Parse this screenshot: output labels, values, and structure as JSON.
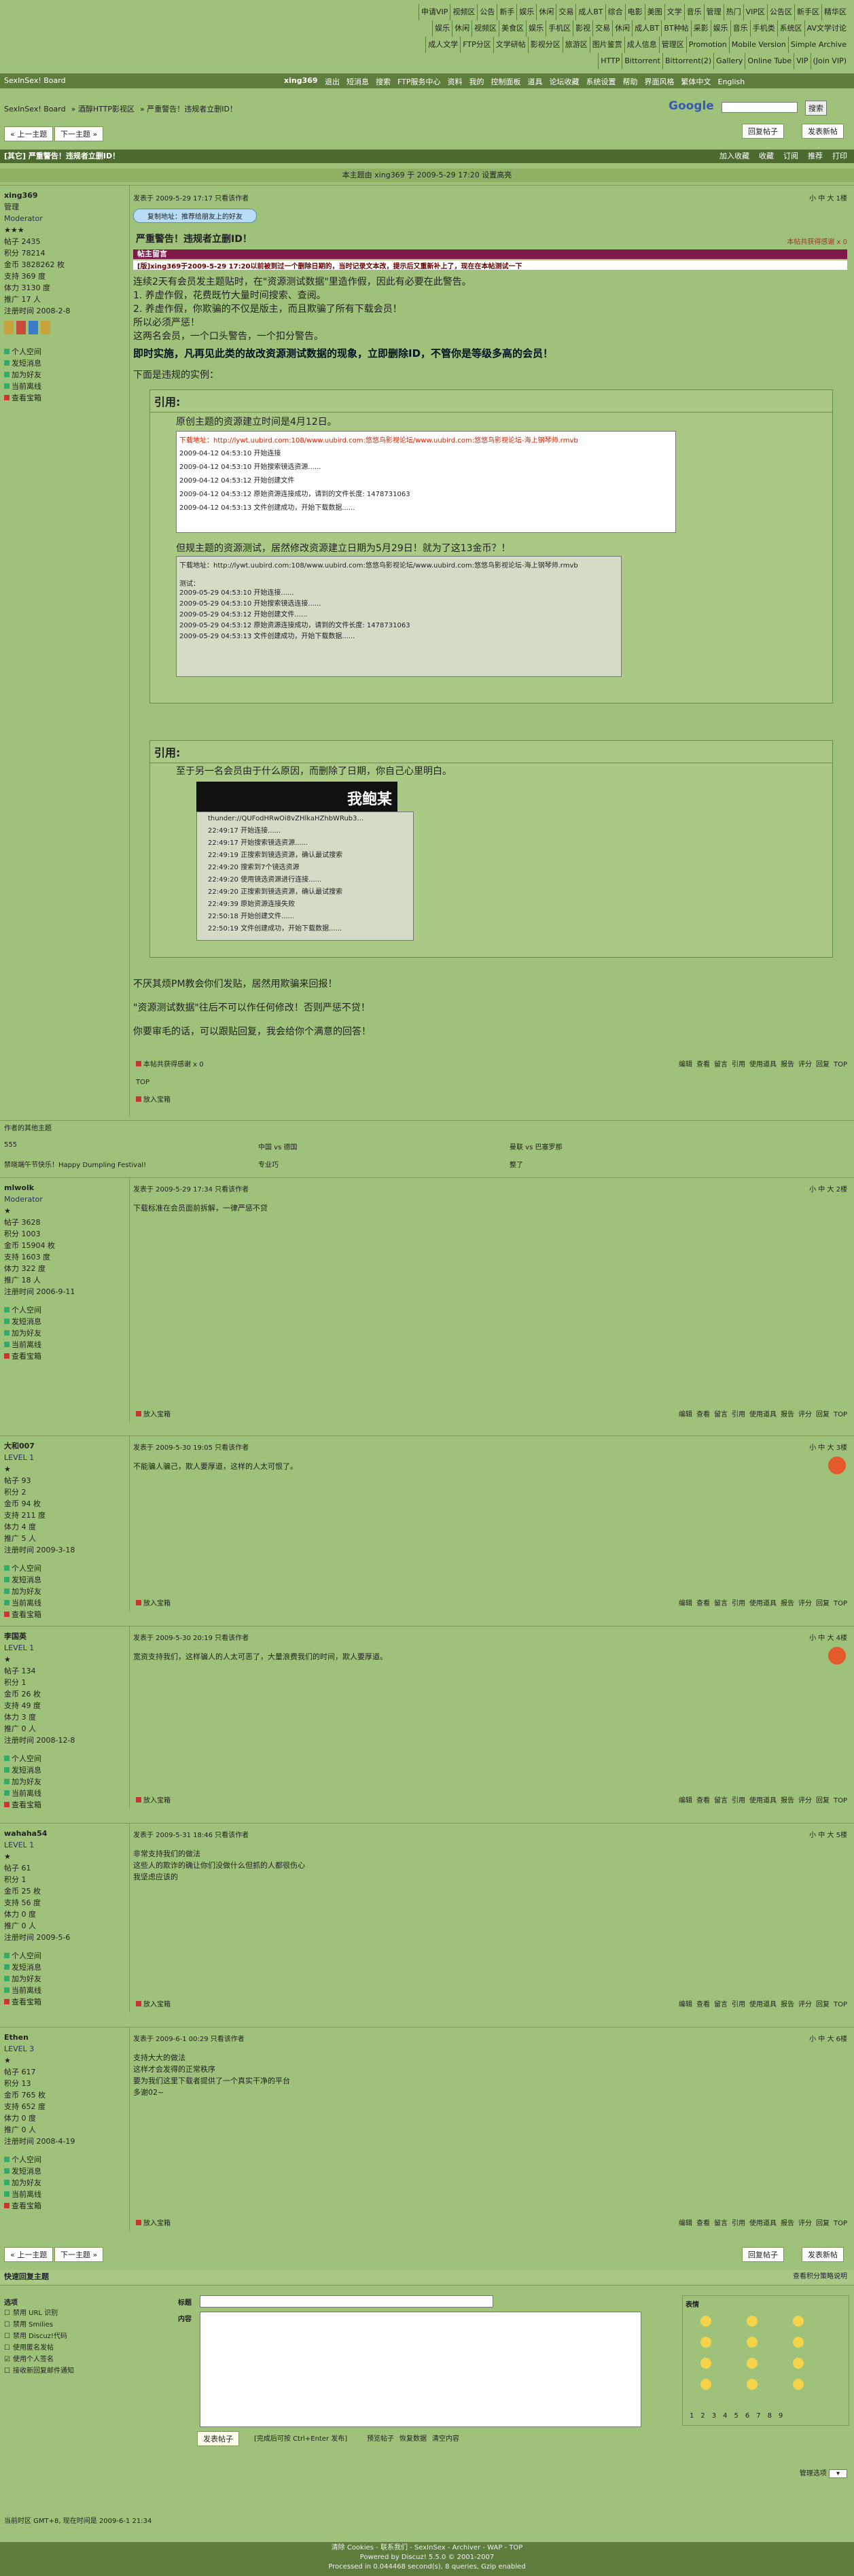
{
  "top_links": [
    "申请VIP",
    "视频区",
    "公告",
    "新手",
    "娱乐",
    "休闲",
    "交易",
    "成人BT",
    "综合",
    "电影",
    "美图",
    "文学",
    "音乐",
    "管理",
    "热门",
    "VIP区",
    "公告区",
    "新手区",
    "精华区",
    "娱乐",
    "休闲",
    "视频区",
    "美食区",
    "娱乐",
    "手机区",
    "影视",
    "交易",
    "休闲",
    "成人BT",
    "BT种帖",
    "采影",
    "娱乐",
    "音乐",
    "手机类",
    "系统区",
    "AV文学讨论",
    "成人文学",
    "FTP分区",
    "文学研帖",
    "影视分区",
    "旅游区",
    "图片鉴赏",
    "成人信息",
    "管理区",
    "Promotion",
    "Mobile Version",
    "Simple Archive",
    "HTTP",
    "Bittorrent",
    "Bittorrent(2)",
    "Gallery",
    "Online Tube",
    "VIP",
    "(Join VIP)"
  ],
  "navbar": {
    "board": "SexInSex! Board",
    "user": "xing369",
    "items": [
      "退出",
      "短消息",
      "搜索",
      "FTP服务中心",
      "资料",
      "我的",
      "控制面板",
      "道具",
      "论坛收藏",
      "系统设置",
      "帮助",
      "界面风格",
      "繁体中文",
      "English"
    ]
  },
  "breadcrumb": [
    "SexInSex! Board",
    "» 酒醇HTTP影视区",
    "» 严重警告！违规者立删ID！"
  ],
  "google": "Google",
  "search_btn": "搜索",
  "buttons": {
    "reply": "回复帖子",
    "new": "发表新帖",
    "prev": "« 上一主题",
    "next": "下一主题 »"
  },
  "thread_title": "[其它] 严重警告！违规者立删ID！",
  "thread_tools": [
    "加入收藏",
    "收藏",
    "订阅",
    "推荐",
    "打印"
  ],
  "view_line": "本主题由 xing369 于 2009-5-29 17:20 设置高亮",
  "post1": {
    "author": "xing369",
    "title": "管理",
    "rank": "Moderator",
    "level": "Moderator",
    "stats": [
      "帖子 2435",
      "积分 78214",
      "金币 3828262 枚",
      "支持 369 度",
      "体力 3130 度",
      "推广 17 人",
      "注册时间 2008-2-8"
    ],
    "links": [
      "个人空间",
      "发短消息",
      "加为好友",
      "当前离线",
      "查看宝箱"
    ],
    "meta": "发表于 2009-5-29 17:17  只看该作者",
    "fontsize": "小 中 大  1楼",
    "copy": "复制地址：推荐给朋友上的好友",
    "heading": "严重警告！违规者立删ID！",
    "notice": "帖主留言",
    "warn": "[版]xing369于2009-5-29 17:20以前被到过一个删除日期的，当时记录文本改，提示后又重新补上了，现在在本帖测试一下",
    "lines": [
      "连续2天有会员发主题贴时，在\"资源测试数据\"里造作假，因此有必要在此警告。",
      "1. 养虚作假，花费既竹大量时间搜索、查阅。",
      "2. 养虚作假，你欺骗的不仅是版主，而且欺骗了所有下载会员！",
      "所以必须严惩！",
      "这两名会员，一个口头警告，一个扣分警告。"
    ],
    "bold_line": "即时实施，凡再见此类的故改资源测试数据的现象，立即删除ID，不管你是等级多高的会员！",
    "example": "下面是违规的实例：",
    "quote1_title": "引用:",
    "q1_text": "原创主题的资源建立时间是4月12日。",
    "q1_link": "下载地址：http://lywt.uubird.com:108/www.uubird.com:悠悠鸟影视论坛/www.uubird.com:悠悠鸟影视论坛-海上钢琴师.rmvb",
    "q1_log": [
      "2009-04-12 04:53:10 开始连接",
      "2009-04-12 04:53:10 开始搜索镜选资源......",
      "2009-04-12 04:53:12 开始创建文件",
      "2009-04-12 04:53:12 原始资源连接成功，请到的文件长度: 1478731063",
      "2009-04-12 04:53:13 文件创建成功，开始下载数据......"
    ],
    "q1_text2": "但规主题的资源测试，居然修改资源建立日期为5月29日！就为了这13金币？！",
    "q1_link2": "下载地址：http://lywt.uubird.com:108/www.uubird.com:悠悠鸟影视论坛/www.uubird.com:悠悠鸟影视论坛-海上钢琴师.rmvb",
    "q1_test": "测试：",
    "q1_log2": [
      "2009-05-29 04:53:10 开始连接......",
      "2009-05-29 04:53:10 开始搜索镜选连接......",
      "2009-05-29 04:53:12 开始创建文件......",
      "2009-05-29 04:53:12 原始资源连接成功，请到的文件长度: 1478731063",
      "2009-05-29 04:53:13 文件创建成功，开始下载数据......"
    ],
    "quote2_title": "引用:",
    "q2_text": "至于另一名会员由于什么原因，而删除了日期，你自己心里明白。",
    "q2_banner": "我鲍某",
    "q2_file": "thunder://QUFodHRwOi8vZHlkaHZhbWRub3...",
    "q2_log": [
      "22:49:17 开始连接......",
      "22:49:17 开始搜索镜选资源......",
      "22:49:19 正搜索到镜选资源，确认最试搜索",
      "22:49:20 搜索到7个镜选资源",
      "22:49:20 使用镜选资源进行连接......",
      "22:49:20 正搜索到镜选资源，确认最试搜索",
      "22:49:39 原始资源连接失败",
      "22:50:18 开始创建文件......",
      "22:50:19 文件创建成功，开始下载数据......"
    ],
    "after": [
      "不厌其烦PM教会你们发贴，居然用欺骗来回报！",
      "\"资源测试数据\"往后不可以作任何修改！否则严惩不贷！",
      "你要审毛的话，可以跟贴回复，我会给你个满意的回答！"
    ],
    "money": "本帖共获得感谢 x 0",
    "ops": [
      "编辑",
      "查看",
      "留言",
      "引用",
      "使用道具",
      "报告",
      "评分",
      "回复",
      "TOP"
    ],
    "top": "TOP",
    "inbox": "放入宝箱"
  },
  "related_title": "作者的其他主题",
  "related": [
    "555",
    "中国 vs 德国",
    "曼联 vs 巴塞罗那",
    "禁晓端午节快乐！Happy Dumpling Festival!",
    "专业巧",
    "整了"
  ],
  "posts": [
    {
      "author": "mlwolk",
      "rank": "Moderator",
      "stats": [
        "帖子 3628",
        "积分 1003",
        "金币 15904 枚",
        "支持 1603 度",
        "体力 322 度",
        "推广 18 人",
        "注册时间 2006-9-11"
      ],
      "meta": "发表于 2009-5-29 17:34  只看该作者",
      "floor": "小 中 大  2楼",
      "content": [
        "下载标准在会员面前拆解，一律严惩不贷"
      ]
    },
    {
      "author": "大和007",
      "rank": "LEVEL 1",
      "stats": [
        "帖子 93",
        "积分 2",
        "金币 94 枚",
        "支持 211 度",
        "体力 4 度",
        "推广 5 人",
        "注册时间 2009-3-18"
      ],
      "meta": "发表于 2009-5-30 19:05  只看该作者",
      "floor": "小 中 大  3楼",
      "content": [
        "不能骗人骗己，欺人要厚道，这样的人太可恨了。"
      ]
    },
    {
      "author": "李国英",
      "rank": "LEVEL 1",
      "stats": [
        "帖子 134",
        "积分 1",
        "金币 26 枚",
        "支持 49 度",
        "体力 3 度",
        "推广 0 人",
        "注册时间 2008-12-8"
      ],
      "meta": "发表于 2009-5-30 20:19  只看该作者",
      "floor": "小 中 大  4楼",
      "content": [
        "宽资支持我们，这样骗人的人太可恶了，大量浪费我们的时间，欺人要厚道。"
      ]
    },
    {
      "author": "wahaha54",
      "rank": "LEVEL 1",
      "stats": [
        "帖子 61",
        "积分 1",
        "金币 25 枚",
        "支持 56 度",
        "体力 0 度",
        "推广 0 人",
        "注册时间 2009-5-6"
      ],
      "meta": "发表于 2009-5-31 18:46  只看该作者",
      "floor": "小 中 大  5楼",
      "content": [
        "非常支持我们的做法",
        "这些人的欺诈的确让你们没做什么但抓的人都很伤心",
        "我坚虑应该的"
      ]
    },
    {
      "author": "Ethen",
      "rank": "LEVEL 3",
      "stats": [
        "帖子 617",
        "积分 13",
        "金币 765 枚",
        "支持 652 度",
        "体力 0 度",
        "推广 0 人",
        "注册时间 2008-4-19"
      ],
      "meta": "发表于 2009-6-1 00:29  只看该作者",
      "floor": "小 中 大  6楼",
      "content": [
        "支持大大的做法",
        "这样才会发得的正常秩序",
        "要为我们这里下载者提供了一个真实干净的平台",
        "多谢02~"
      ]
    }
  ],
  "quick": {
    "title": "快速回复主题",
    "right": "查看积分策略说明",
    "options": [
      "禁用 URL 识别",
      "禁用 Smilies",
      "禁用 Discuz!代码",
      "使用匿名发帖",
      "使用个人签名",
      "接收新回复邮件通知"
    ],
    "label_title": "标题",
    "label_content": "内容",
    "smiley_title": "表情",
    "pages": [
      "1",
      "2",
      "3",
      "4",
      "5",
      "6",
      "7",
      "8",
      "9"
    ],
    "submit": "发表帖子",
    "hint": "[完成后可按 Ctrl+Enter 发布]",
    "links": [
      "预览帖子",
      "恢复数据",
      "清空内容"
    ],
    "mod": "管理选项"
  },
  "bottom": {
    "tz": "当前时区 GMT+8, 现在时间是 2009-6-1 21:34",
    "links": "清除 Cookies - 联系我们 - SexInSex - Archiver - WAP - TOP",
    "powered": "Powered by Discuz! 5.5.0 © 2001-2007",
    "processed": "Processed in 0.044468 second(s), 8 queries, Gzip enabled"
  }
}
